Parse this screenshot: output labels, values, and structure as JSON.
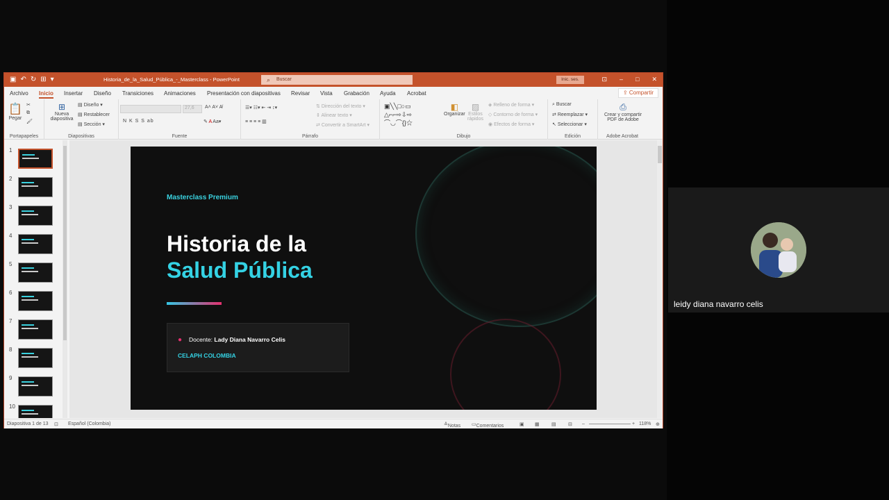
{
  "window": {
    "title": "Historia_de_la_Salud_Pública_-_Masterclass - PowerPoint",
    "search_placeholder": "Buscar",
    "signin": "Inic. ses.",
    "share": "Compartir"
  },
  "tabs": [
    "Archivo",
    "Inicio",
    "Insertar",
    "Diseño",
    "Transiciones",
    "Animaciones",
    "Presentación con diapositivas",
    "Revisar",
    "Vista",
    "Grabación",
    "Ayuda",
    "Acrobat"
  ],
  "ribbon": {
    "portapapeles": {
      "label": "Portapapeles",
      "pegar": "Pegar"
    },
    "diapositivas": {
      "label": "Diapositivas",
      "nueva": "Nueva",
      "diapositiva": "diapositiva",
      "diseno": "Diseño",
      "restablecer": "Restablecer",
      "seccion": "Sección"
    },
    "fuente": {
      "label": "Fuente",
      "size": "27,6",
      "styles": "N  K  S  S  ab"
    },
    "parrafo": {
      "label": "Párrafo",
      "direccion": "Dirección del texto",
      "alinear": "Alinear texto",
      "smartart": "Convertir a SmartArt"
    },
    "dibujo": {
      "label": "Dibujo",
      "organizar": "Organizar",
      "estilos": "Estilos",
      "rapidos": "rápidos",
      "relleno": "Relleno de forma",
      "contorno": "Contorno de forma",
      "efectos": "Efectos de forma"
    },
    "edicion": {
      "label": "Edición",
      "buscar": "Buscar",
      "reemplazar": "Reemplazar",
      "seleccionar": "Seleccionar"
    },
    "acrobat": {
      "label": "Adobe Acrobat",
      "crear": "Crear y compartir",
      "pdf": "PDF de Adobe"
    }
  },
  "thumbnails": [
    "1",
    "2",
    "3",
    "4",
    "5",
    "6",
    "7",
    "8",
    "9",
    "10"
  ],
  "slide": {
    "kicker": "Masterclass Premium",
    "title_line1": "Historia de la",
    "title_line2": "Salud Pública",
    "docente_label": "Docente:",
    "docente_name": "Lady Diana Navarro Celis",
    "org": "CELAPH COLOMBIA"
  },
  "status": {
    "slide_count": "Diapositiva 1 de 13",
    "language": "Español (Colombia)",
    "notas": "Notas",
    "comentarios": "Comentarios",
    "zoom": "118%"
  },
  "participant": {
    "name": "leidy diana navarro celis"
  },
  "colors": {
    "accent": "#c4522b",
    "cyan": "#34d2e4",
    "pink": "#e4306e"
  }
}
